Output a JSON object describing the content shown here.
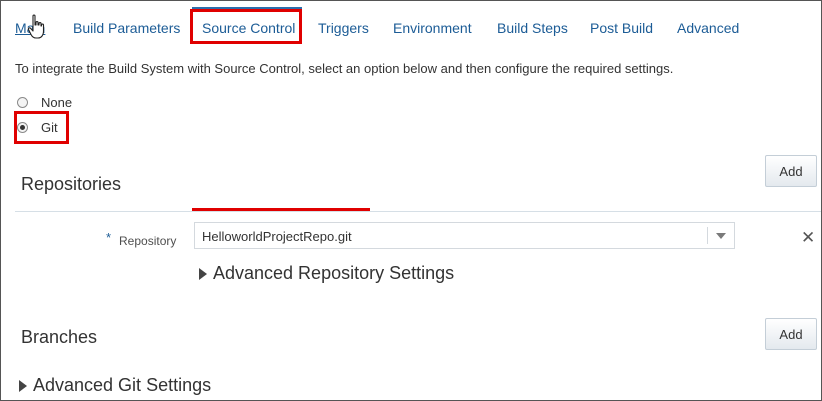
{
  "tabs": [
    {
      "label": "Main"
    },
    {
      "label": "Build Parameters"
    },
    {
      "label": "Source Control"
    },
    {
      "label": "Triggers"
    },
    {
      "label": "Environment"
    },
    {
      "label": "Build Steps"
    },
    {
      "label": "Post Build"
    },
    {
      "label": "Advanced"
    }
  ],
  "active_tab": "Source Control",
  "intro_text": "To integrate the Build System with Source Control, select an option below and then configure the required settings.",
  "source_options": [
    {
      "label": "None",
      "selected": false
    },
    {
      "label": "Git",
      "selected": true
    }
  ],
  "repositories": {
    "title": "Repositories",
    "add_label": "Add",
    "repository_field": {
      "required_marker": "*",
      "label": "Repository",
      "value": "HelloworldProjectRepo.git"
    },
    "advanced_label": "Advanced Repository Settings"
  },
  "branches": {
    "title": "Branches",
    "add_label": "Add"
  },
  "advanced_git_label": "Advanced Git Settings",
  "colors": {
    "link": "#1c5c96",
    "highlight": "#e00000",
    "active_tab_bar": "#2c6eab"
  }
}
